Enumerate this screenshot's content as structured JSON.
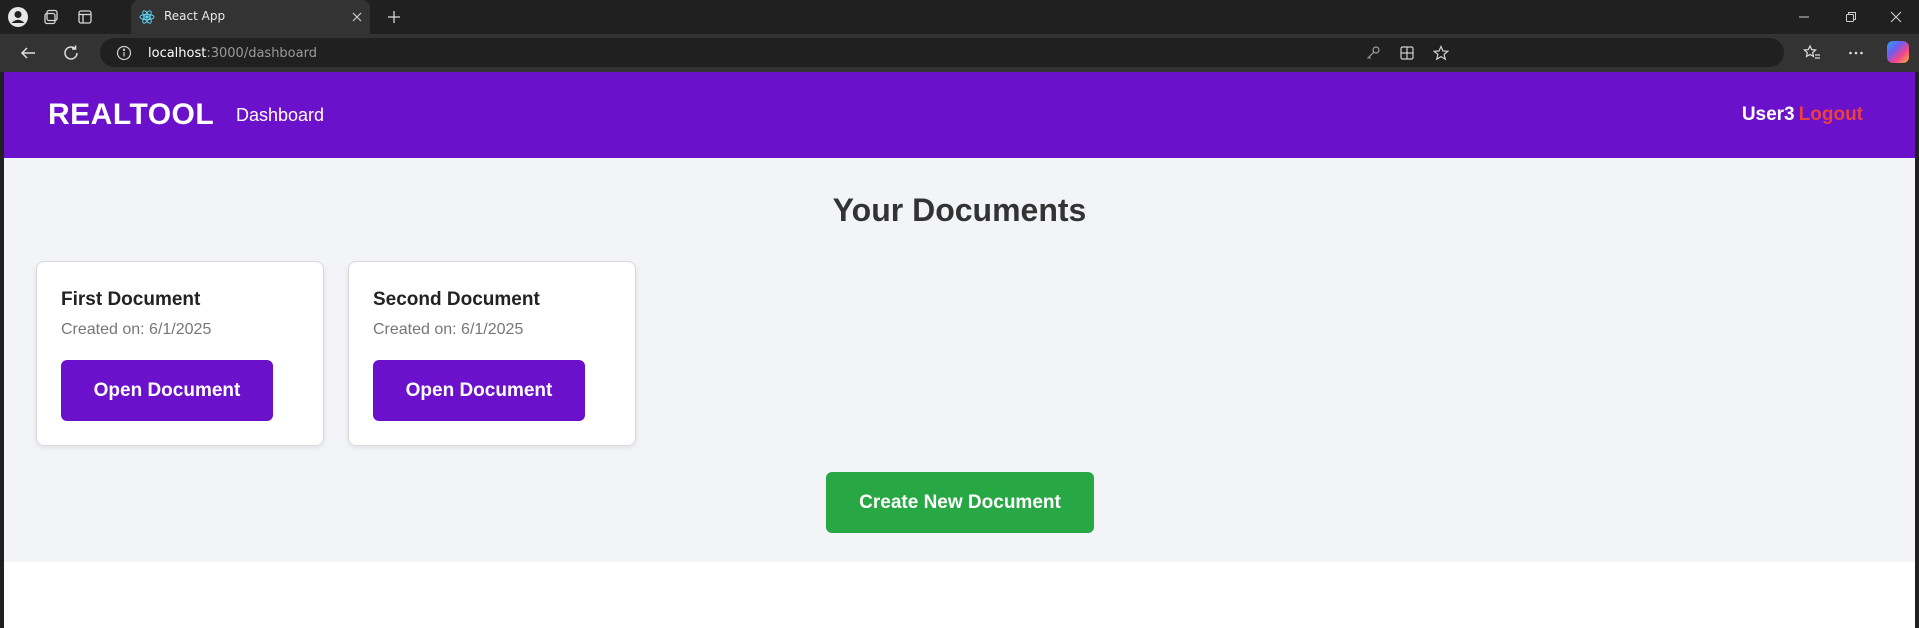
{
  "browser": {
    "tab_title": "React App",
    "url_host": "localhost",
    "url_path": ":3000/dashboard"
  },
  "app": {
    "brand": "REALTOOL",
    "nav_dashboard": "Dashboard",
    "username": "User3",
    "logout": "Logout",
    "page_title": "Your Documents",
    "documents": [
      {
        "title": "First Document",
        "created": "Created on: 6/1/2025",
        "open_label": "Open Document"
      },
      {
        "title": "Second Document",
        "created": "Created on: 6/1/2025",
        "open_label": "Open Document"
      }
    ],
    "create_label": "Create New Document"
  },
  "colors": {
    "header": "#6b11cc",
    "primary_button": "#6b11cc",
    "create_button": "#28a745",
    "logout": "#e8413e"
  }
}
